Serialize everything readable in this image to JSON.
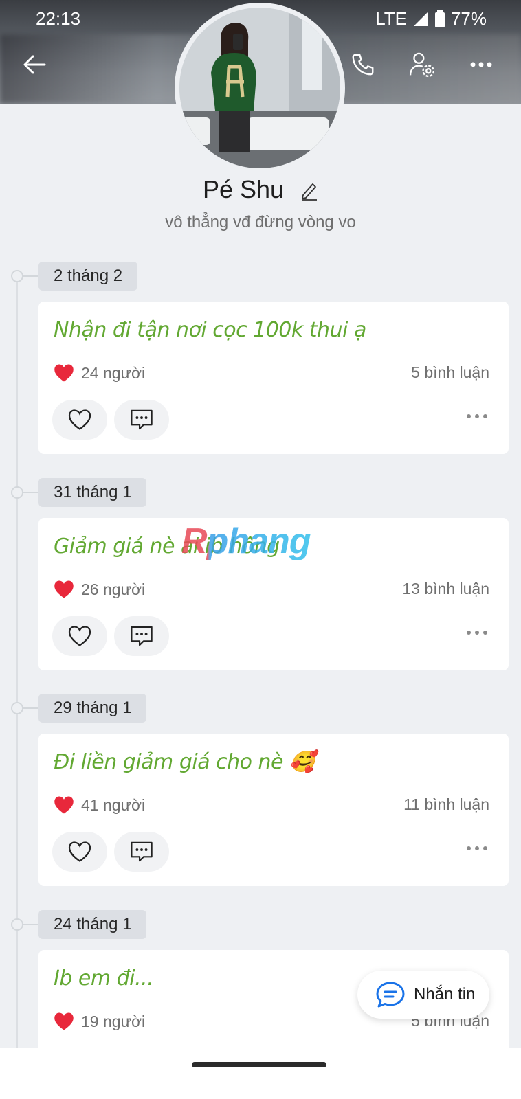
{
  "status": {
    "time": "22:13",
    "network": "LTE",
    "battery": "77%"
  },
  "profile": {
    "name": "Pé Shu",
    "bio": "vô thẳng vđ đừng vòng vo"
  },
  "posts": [
    {
      "date": "2 tháng 2",
      "text": "Nhận đi tận nơi cọc 100k thui ạ",
      "likes": "24 người",
      "comments": "5 bình luận"
    },
    {
      "date": "31 tháng 1",
      "text": "Giảm giá nè ai ib hông",
      "likes": "26 người",
      "comments": "13 bình luận"
    },
    {
      "date": "29 tháng 1",
      "text": "Đi liền giảm giá cho nè 🥰",
      "likes": "41 người",
      "comments": "11 bình luận"
    },
    {
      "date": "24 tháng 1",
      "text": "Ib em đi...",
      "likes": "19 người",
      "comments": "5 bình luận"
    }
  ],
  "watermark": "Rphang",
  "fab": {
    "label": "Nhắn tin"
  },
  "colors": {
    "accent": "#62a832",
    "heart": "#e8283b",
    "background": "#eef0f3"
  },
  "icons": {
    "back": "back-arrow-icon",
    "call": "phone-icon",
    "settings": "user-settings-icon",
    "more": "more-icon",
    "edit": "pencil-icon",
    "like": "heart-outline-icon",
    "comment": "comment-icon",
    "message": "chat-bubble-icon"
  }
}
